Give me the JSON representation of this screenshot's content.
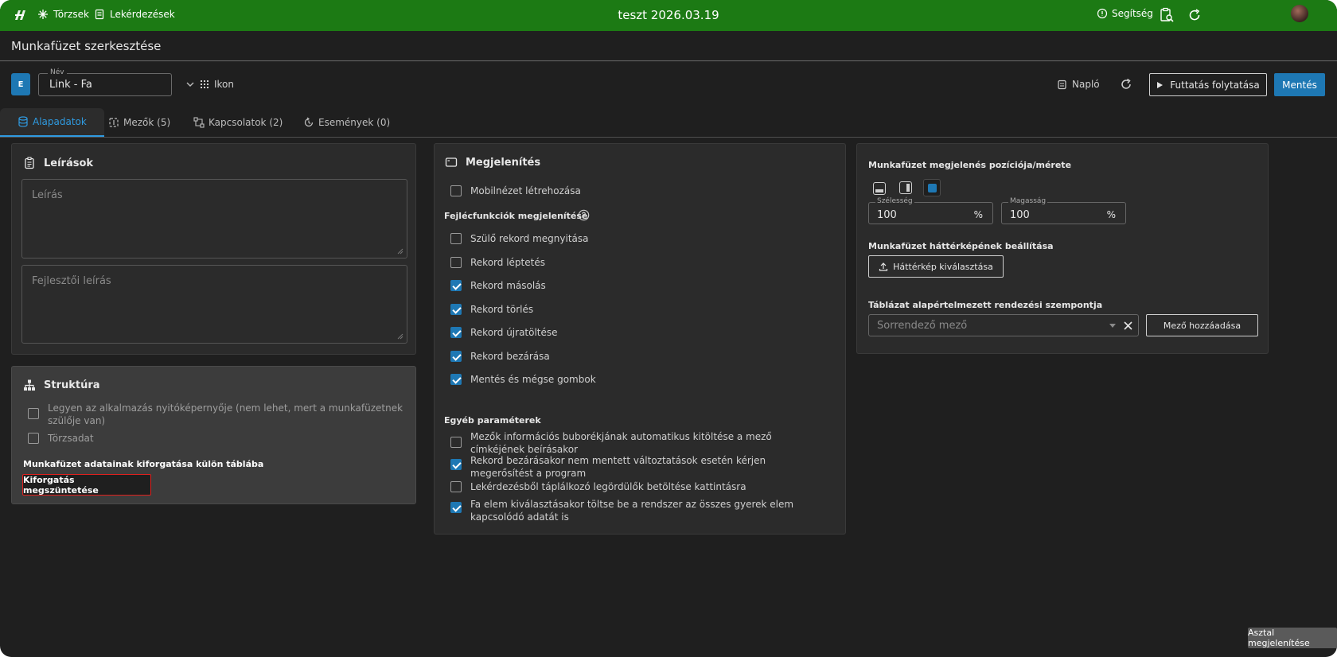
{
  "topbar": {
    "nav": [
      {
        "label": "Törzsek",
        "icon": "asterisk-icon"
      },
      {
        "label": "Lekérdezések",
        "icon": "document-icon"
      }
    ],
    "title": "teszt 2026.03.19",
    "help_label": "Segítség",
    "bg_color": "#1c7a14"
  },
  "page": {
    "title": "Munkafüzet szerkesztése"
  },
  "form": {
    "badge": "E",
    "name_label": "Név",
    "name_value": "Link - Fa",
    "icon_label": "Ikon",
    "log_label": "Napló",
    "run_label": "Futtatás folytatása",
    "save_label": "Mentés",
    "accent": "#1e78b4"
  },
  "tabs": [
    {
      "label": "Alapadatok",
      "icon": "database-icon",
      "active": true
    },
    {
      "label": "Mezők (5)",
      "icon": "fields-icon",
      "active": false
    },
    {
      "label": "Kapcsolatok (2)",
      "icon": "relations-icon",
      "active": false
    },
    {
      "label": "Események (0)",
      "icon": "events-icon",
      "active": false
    }
  ],
  "descriptions": {
    "title": "Leírások",
    "description_placeholder": "Leírás",
    "dev_description_placeholder": "Fejlesztői leírás"
  },
  "structure": {
    "title": "Struktúra",
    "options": [
      {
        "label": "Legyen az alkalmazás nyitóképernyője (nem lehet, mert a munkafüzetnek szülője van)",
        "checked": false
      },
      {
        "label": "Törzsadat",
        "checked": false
      }
    ],
    "pivot_heading": "Munkafüzet adatainak kiforgatása külön táblába",
    "pivot_button": "Kiforgatás megszüntetése"
  },
  "display": {
    "title": "Megjelenítés",
    "mobile_view": {
      "label": "Mobilnézet létrehozása",
      "checked": false
    },
    "header_functions_heading": "Fejlécfunkciók megjelenítése",
    "header_functions": [
      {
        "label": "Szülő rekord megnyitása",
        "checked": false
      },
      {
        "label": "Rekord léptetés",
        "checked": false
      },
      {
        "label": "Rekord másolás",
        "checked": true
      },
      {
        "label": "Rekord törlés",
        "checked": true
      },
      {
        "label": "Rekord újratöltése",
        "checked": true
      },
      {
        "label": "Rekord bezárása",
        "checked": true
      },
      {
        "label": "Mentés és mégse gombok",
        "checked": true
      }
    ],
    "other_params_heading": "Egyéb paraméterek",
    "other_params": [
      {
        "label": "Mezők információs buborékjának automatikus kitöltése a mező címkéjének beírásakor",
        "checked": false
      },
      {
        "label": "Rekord bezárásakor nem mentett változtatások esetén kérjen megerősítést a program",
        "checked": true
      },
      {
        "label": "Lekérdezésből táplálkozó legördülők betöltése kattintásra",
        "checked": false
      },
      {
        "label": "Fa elem kiválasztásakor töltse be a rendszer az összes gyerek elem kapcsolódó adatát is",
        "checked": true
      }
    ]
  },
  "workbook": {
    "position_heading": "Munkafüzet megjelenés pozíciója/mérete",
    "width_label": "Szélesség",
    "width_value": "100",
    "height_label": "Magasság",
    "height_value": "100",
    "unit": "%",
    "background_heading": "Munkafüzet háttérképének beállítása",
    "background_button": "Háttérkép kiválasztása",
    "sort_heading": "Táblázat alapértelmezett rendezési szempontja",
    "sort_placeholder": "Sorrendező mező",
    "add_field_button": "Mező hozzáadása"
  },
  "footer": {
    "desktop_button": "Asztal megjelenítése"
  }
}
